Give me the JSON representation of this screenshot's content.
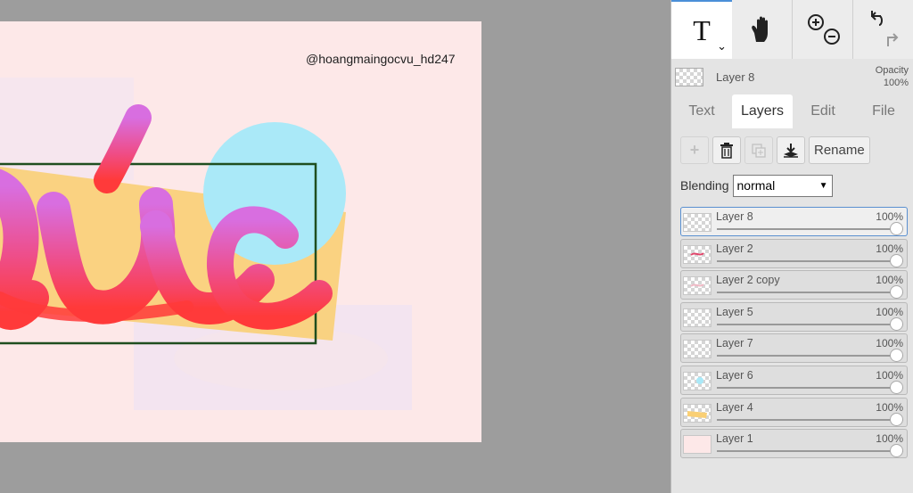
{
  "canvas": {
    "watermark": "@hoangmaingocvu_hd247",
    "artboard_bg": "#fde8e8"
  },
  "toolbar": {
    "tools": [
      "text-tool",
      "hand-tool",
      "zoom-tool",
      "undo-redo"
    ]
  },
  "current_layer": {
    "name": "Layer 8",
    "opacity_label": "Opacity",
    "opacity_value": "100%"
  },
  "tabs": [
    "Text",
    "Layers",
    "Edit",
    "File"
  ],
  "active_tab": "Layers",
  "layer_controls": {
    "rename_label": "Rename"
  },
  "blending": {
    "label": "Blending",
    "value": "normal"
  },
  "layers": [
    {
      "name": "Layer 8",
      "opacity": "100%"
    },
    {
      "name": "Layer 2",
      "opacity": "100%"
    },
    {
      "name": "Layer 2 copy",
      "opacity": "100%"
    },
    {
      "name": "Layer 5",
      "opacity": "100%"
    },
    {
      "name": "Layer 7",
      "opacity": "100%"
    },
    {
      "name": "Layer 6",
      "opacity": "100%"
    },
    {
      "name": "Layer 4",
      "opacity": "100%"
    },
    {
      "name": "Layer 1",
      "opacity": "100%"
    }
  ],
  "colors": {
    "accent": "#4a8fd8",
    "panel_bg": "#e4e4e4",
    "workspace_bg": "#9d9d9d"
  }
}
